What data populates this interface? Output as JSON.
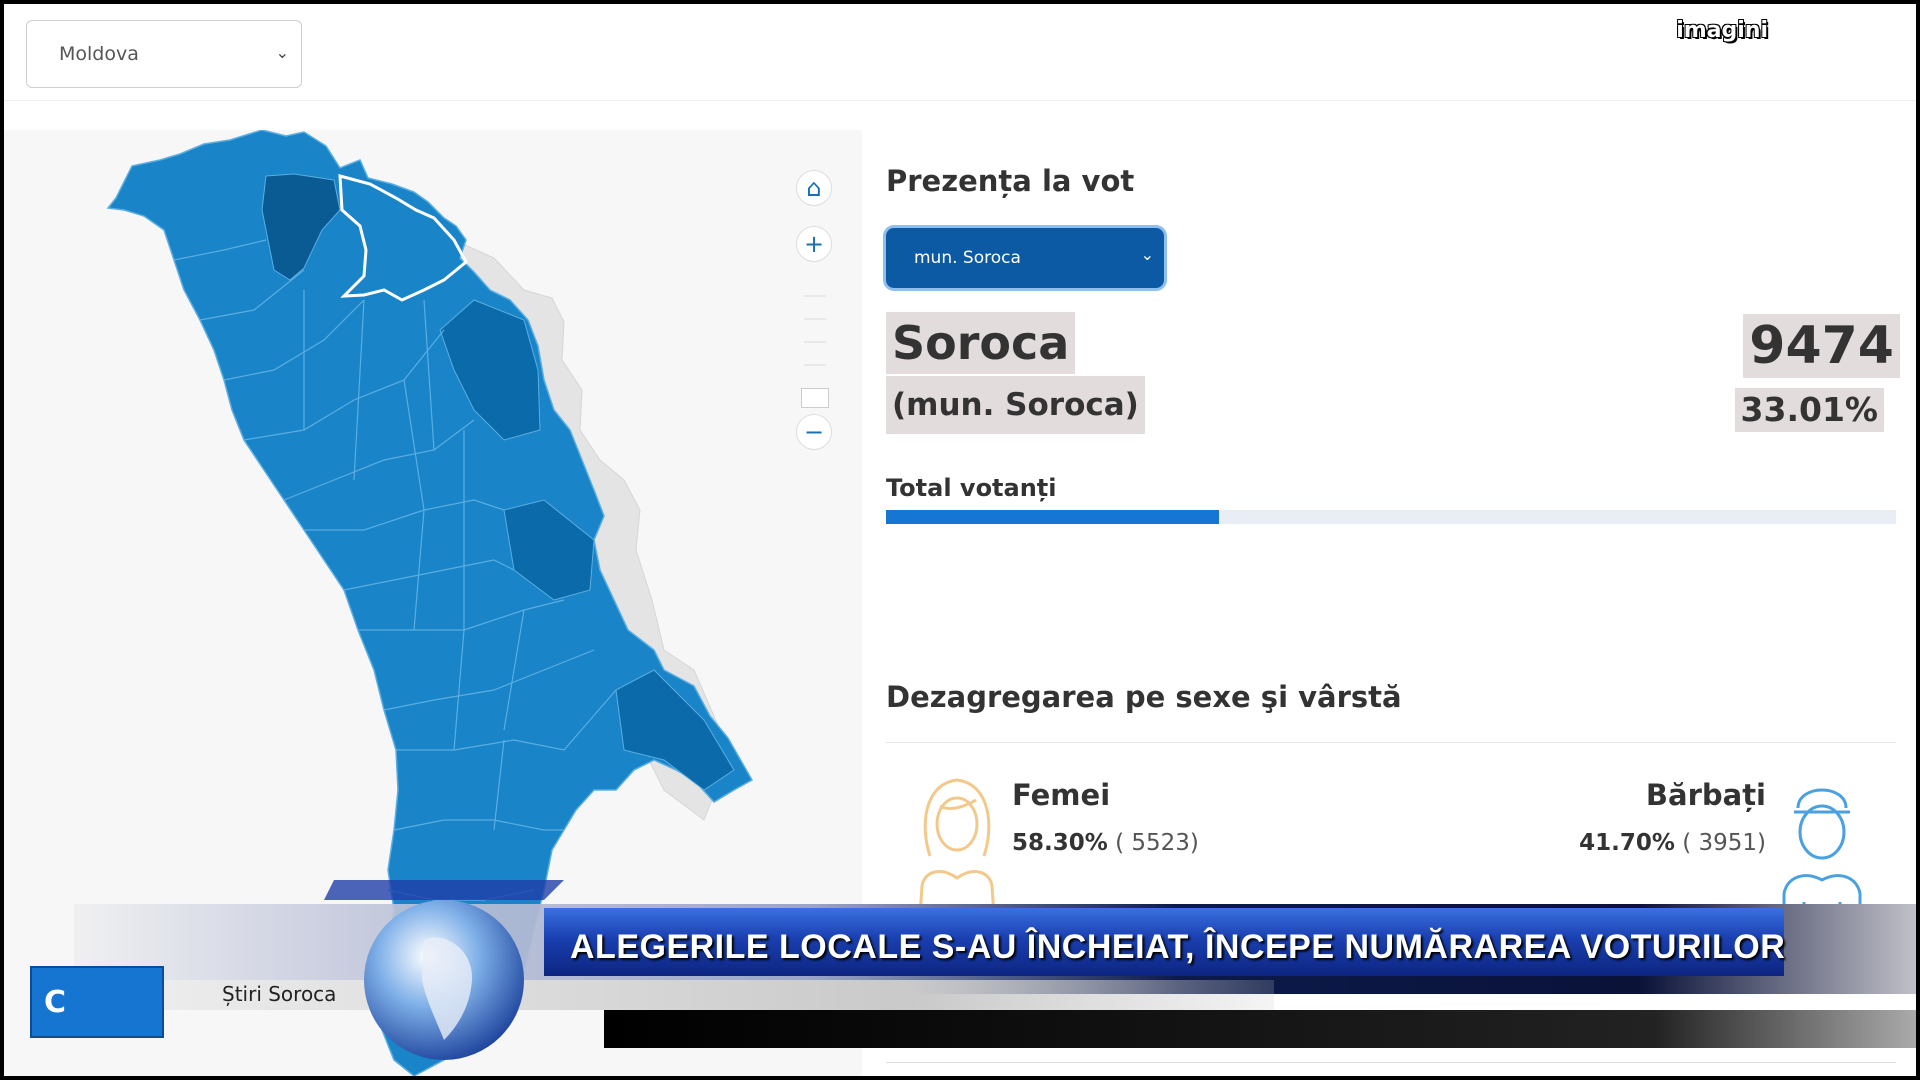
{
  "country_select": {
    "value": "Moldova"
  },
  "watermark": "imagini",
  "map": {
    "home_icon": "home-icon",
    "zoom_in": "+",
    "zoom_out": "−",
    "colors": {
      "region_fill": "#1a84c8",
      "region_dark": "#0b6aaa",
      "selected_region": "#0a5a94",
      "neighbor": "#e6e6e6",
      "border": "#5aaee2"
    }
  },
  "turnout": {
    "heading": "Prezența la vot",
    "district_select": "mun. Soroca",
    "district_name": "Soroca",
    "district_sub": "(mun. Soroca)",
    "voters_count": "9474",
    "voters_percent": "33.01%",
    "total_label": "Total votanți",
    "progress_fraction": 0.3301
  },
  "gender": {
    "heading": "Dezagregarea pe sexe şi vârstă",
    "women": {
      "label": "Femei",
      "percent": "58.30%",
      "count": "( 5523)"
    },
    "men": {
      "label": "Bărbați",
      "percent": "41.70%",
      "count": "( 3951)"
    }
  },
  "broadcast": {
    "headline": "ALEGERILE LOCALE S-AU ÎNCHEIAT, ÎNCEPE NUMĂRAREA VOTURILOR",
    "source": "Știri Soroca",
    "logo": "C"
  }
}
